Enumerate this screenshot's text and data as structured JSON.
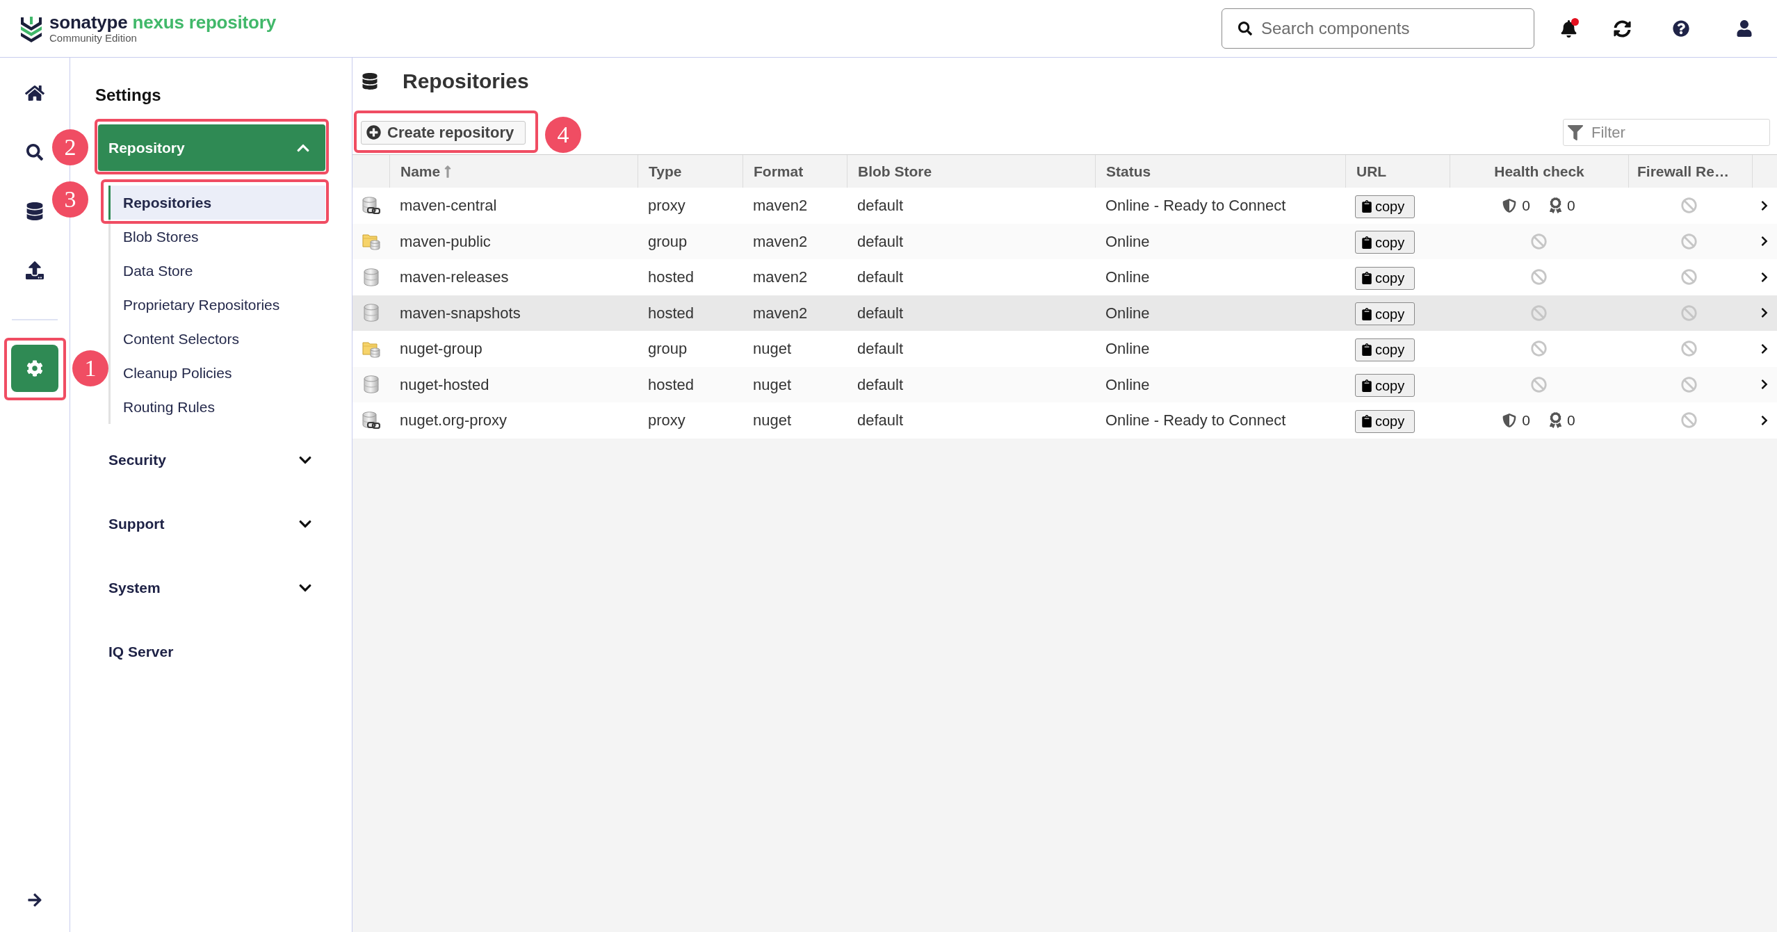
{
  "header": {
    "logo": {
      "brand": "sonatype",
      "product": "nexus repository",
      "edition": "Community Edition"
    },
    "search": {
      "placeholder": "Search components"
    },
    "notifications_unread": true
  },
  "rail": {
    "items": [
      {
        "kind": "home",
        "selected": false
      },
      {
        "kind": "search",
        "selected": false
      },
      {
        "kind": "browse",
        "selected": false
      },
      {
        "kind": "upload",
        "selected": false
      }
    ],
    "admin_items": [
      {
        "kind": "settings",
        "selected": true
      }
    ]
  },
  "settings_nav": {
    "title": "Settings",
    "sections": [
      {
        "kind": "group",
        "label": "Repository",
        "expanded": true,
        "children": [
          {
            "label": "Repositories",
            "selected": true
          },
          {
            "label": "Blob Stores",
            "selected": false
          },
          {
            "label": "Data Store",
            "selected": false
          },
          {
            "label": "Proprietary Repositories",
            "selected": false
          },
          {
            "label": "Content Selectors",
            "selected": false
          },
          {
            "label": "Cleanup Policies",
            "selected": false
          },
          {
            "label": "Routing Rules",
            "selected": false
          }
        ]
      },
      {
        "kind": "group",
        "label": "Security",
        "expanded": false
      },
      {
        "kind": "group",
        "label": "Support",
        "expanded": false
      },
      {
        "kind": "group",
        "label": "System",
        "expanded": false
      },
      {
        "kind": "link",
        "label": "IQ Server"
      }
    ]
  },
  "page": {
    "title": "Repositories",
    "create_button": "Create repository",
    "filter": {
      "placeholder": "Filter"
    }
  },
  "table": {
    "columns": [
      {
        "label": "Name",
        "sorted": true
      },
      {
        "label": "Type",
        "sorted": false
      },
      {
        "label": "Format",
        "sorted": false
      },
      {
        "label": "Blob Store",
        "sorted": false
      },
      {
        "label": "Status",
        "sorted": false
      },
      {
        "label": "URL",
        "sorted": false
      },
      {
        "label": "Health check",
        "sorted": false
      },
      {
        "label": "Firewall Re…",
        "sorted": false
      }
    ],
    "rows": [
      {
        "kind": "proxy",
        "name": "maven-central",
        "type": "proxy",
        "format": "maven2",
        "blob_store": "default",
        "status": "Online - Ready to Connect",
        "url": "copy",
        "health_check": {
          "kind": "counts",
          "security": "0",
          "license": "0"
        },
        "selected": false
      },
      {
        "kind": "group",
        "name": "maven-public",
        "type": "group",
        "format": "maven2",
        "blob_store": "default",
        "status": "Online",
        "url": "copy",
        "health_check": {
          "kind": "unavailable"
        },
        "selected": false
      },
      {
        "kind": "hosted",
        "name": "maven-releases",
        "type": "hosted",
        "format": "maven2",
        "blob_store": "default",
        "status": "Online",
        "url": "copy",
        "health_check": {
          "kind": "unavailable"
        },
        "selected": false
      },
      {
        "kind": "hosted",
        "name": "maven-snapshots",
        "type": "hosted",
        "format": "maven2",
        "blob_store": "default",
        "status": "Online",
        "url": "copy",
        "health_check": {
          "kind": "unavailable"
        },
        "selected": true
      },
      {
        "kind": "group",
        "name": "nuget-group",
        "type": "group",
        "format": "nuget",
        "blob_store": "default",
        "status": "Online",
        "url": "copy",
        "health_check": {
          "kind": "unavailable"
        },
        "selected": false
      },
      {
        "kind": "hosted",
        "name": "nuget-hosted",
        "type": "hosted",
        "format": "nuget",
        "blob_store": "default",
        "status": "Online",
        "url": "copy",
        "health_check": {
          "kind": "unavailable"
        },
        "selected": false
      },
      {
        "kind": "proxy",
        "name": "nuget.org-proxy",
        "type": "proxy",
        "format": "nuget",
        "blob_store": "default",
        "status": "Online - Ready to Connect",
        "url": "copy",
        "health_check": {
          "kind": "counts",
          "security": "0",
          "license": "0"
        },
        "selected": false
      }
    ]
  },
  "annotations": [
    {
      "label": "1"
    },
    {
      "label": "2"
    },
    {
      "label": "3"
    },
    {
      "label": "4"
    }
  ]
}
